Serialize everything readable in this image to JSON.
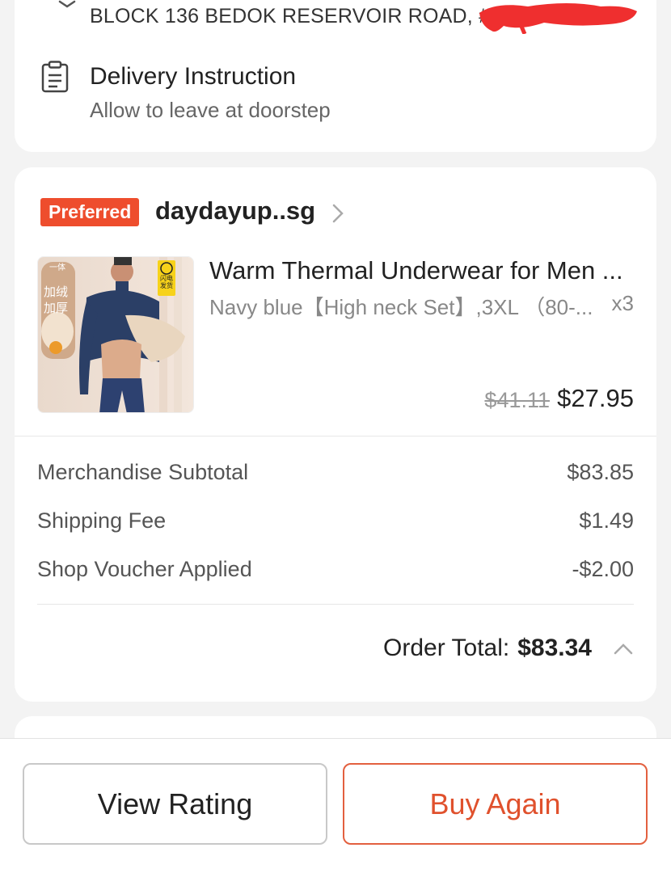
{
  "address": {
    "line": "BLOCK 136 BEDOK RESERVOIR ROAD, #",
    "pin_icon": "map-pin-icon"
  },
  "delivery": {
    "title": "Delivery Instruction",
    "subtitle": "Allow to leave at doorstep",
    "icon": "clipboard-icon"
  },
  "shop": {
    "badge": "Preferred",
    "name": "daydayup..sg",
    "badge_color": "#ee4d2d"
  },
  "product": {
    "title": "Warm Thermal Underwear for Men ...",
    "variant": "Navy blue【High neck Set】,3XL （80-...",
    "quantity": "x3",
    "original_price": "$41.11",
    "price": "$27.95",
    "thumb_text_1": "加绒",
    "thumb_text_2": "加厚",
    "thumb_tag_1": "一体",
    "thumb_tag_2": "闪电发货"
  },
  "summary": {
    "subtotal_label": "Merchandise Subtotal",
    "subtotal_value": "$83.85",
    "shipping_label": "Shipping Fee",
    "shipping_value": "$1.49",
    "voucher_label": "Shop Voucher Applied",
    "voucher_value": "-$2.00",
    "total_label": "Order Total:",
    "total_value": "$83.34"
  },
  "actions": {
    "view_rating": "View Rating",
    "buy_again": "Buy Again",
    "accent_color": "#ee4d2d"
  }
}
